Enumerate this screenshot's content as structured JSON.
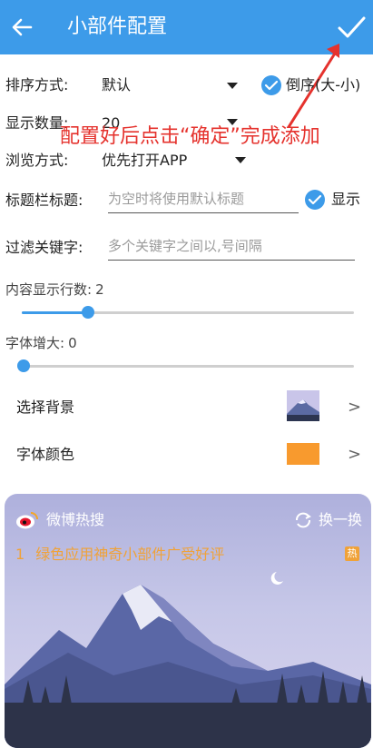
{
  "header": {
    "title": "小部件配置",
    "accent": "#3d9be9"
  },
  "sort": {
    "label": "排序方式:",
    "value": "默认",
    "reverse_label": "倒序(大-小)",
    "reverse_checked": true
  },
  "count": {
    "label": "显示数量:",
    "value": "20"
  },
  "browse": {
    "label": "浏览方式:",
    "value": "优先打开APP"
  },
  "title_field": {
    "label": "标题栏标题:",
    "placeholder": "为空时将使用默认标题",
    "show_label": "显示",
    "show_checked": true
  },
  "filter": {
    "label": "过滤关键字:",
    "placeholder": "多个关键字之间以,号间隔"
  },
  "lines": {
    "label": "内容显示行数:",
    "value": "2",
    "level": 0.2
  },
  "font_size": {
    "label": "字体增大:",
    "value": "0",
    "level": 0.0
  },
  "background": {
    "label": "选择背景",
    "chevron": ">"
  },
  "font_color": {
    "label": "字体颜色",
    "chevron": ">",
    "swatch": "#f89a2e"
  },
  "annotation": {
    "text": "配置好后点击“确定”完成添加",
    "color": "#e5322d"
  },
  "preview": {
    "title": "微博热搜",
    "refresh_label": "换一换",
    "item_index": "1",
    "item_text": "绿色应用神奇小部件广受好评",
    "hot_badge": "热"
  }
}
